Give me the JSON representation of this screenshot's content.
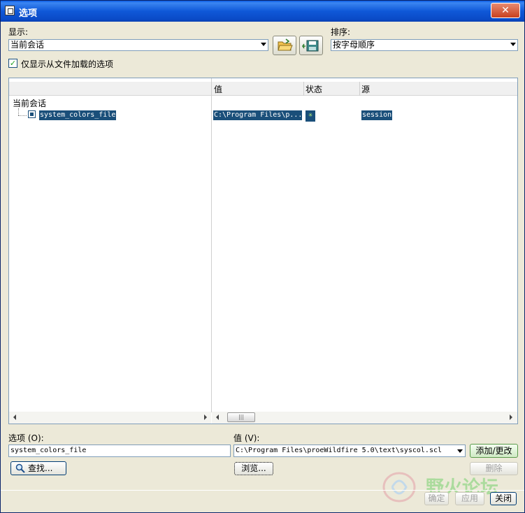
{
  "window": {
    "title": "选项",
    "close_glyph": "✕"
  },
  "display": {
    "label": "显示:",
    "value": "当前会话"
  },
  "sort": {
    "label": "排序:",
    "value": "按字母顺序"
  },
  "filter_checkbox": {
    "label": "仅显示从文件加载的选项",
    "checked": true
  },
  "grid": {
    "columns": [
      "值",
      "状态",
      "源"
    ],
    "root_label": "当前会话",
    "rows": [
      {
        "name": "system_colors_file",
        "value": "C:\\Program Files\\p...",
        "status_icon": "star-status-icon",
        "source": "session"
      }
    ],
    "scroll_thumb": "|||"
  },
  "option_field": {
    "label": "选项 (O):",
    "value": "system_colors_file"
  },
  "value_field": {
    "label": "值 (V):",
    "value": "C:\\Program Files\\proeWildfire 5.0\\text\\syscol.scl"
  },
  "buttons": {
    "find": "查找...",
    "browse": "浏览...",
    "add_change": "添加/更改",
    "delete": "删除",
    "ok": "确定",
    "apply": "应用",
    "close": "关闭"
  },
  "watermark": {
    "text": "野火论坛"
  },
  "colors": {
    "selection": "#1a4f7a",
    "titlebar": "#0a5be4"
  }
}
